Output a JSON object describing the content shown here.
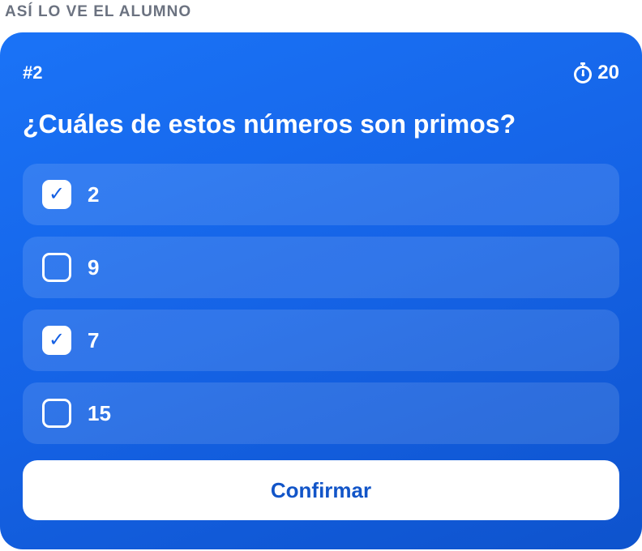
{
  "caption": "ASÍ LO VE EL ALUMNO",
  "question": {
    "number": "#2",
    "timer_value": "20",
    "timer_icon": "stopwatch-icon",
    "text": "¿Cuáles de estos números son primos?"
  },
  "options": [
    {
      "label": "2",
      "checked": true
    },
    {
      "label": "9",
      "checked": false
    },
    {
      "label": "7",
      "checked": true
    },
    {
      "label": "15",
      "checked": false
    }
  ],
  "check_mark": "✓",
  "confirm_label": "Confirmar",
  "colors": {
    "card_gradient_start": "#1a73f7",
    "card_gradient_end": "#0e53cd",
    "confirm_text": "#1255c8",
    "caption_text": "#6b7280"
  }
}
